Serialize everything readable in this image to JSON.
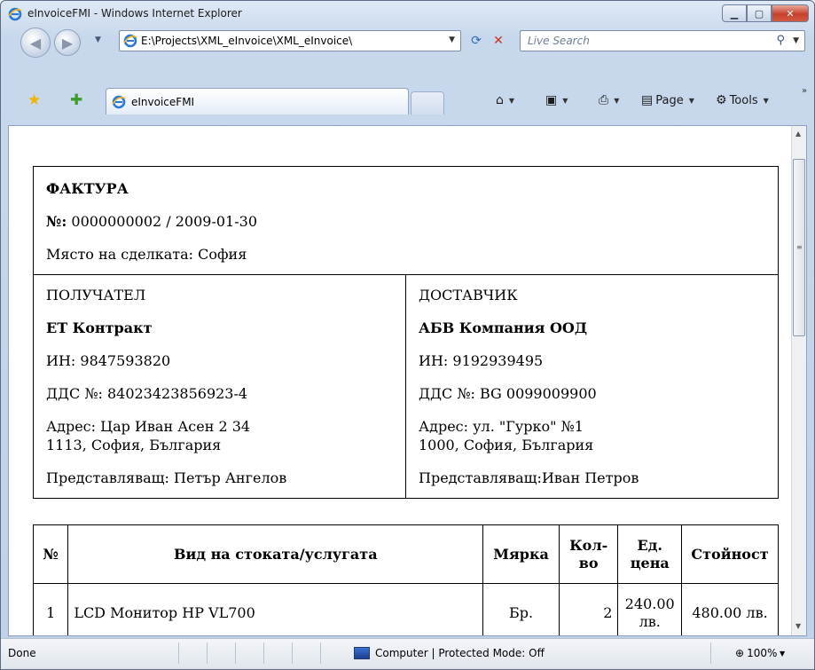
{
  "window": {
    "title": "eInvoiceFMI - Windows Internet Explorer",
    "address": "E:\\Projects\\XML_eInvoice\\XML_eInvoice\\",
    "search_placeholder": "Live Search",
    "tab_title": "eInvoiceFMI",
    "commands": {
      "page": "Page",
      "tools": "Tools"
    },
    "icons": [
      "ie-logo-icon",
      "back-arrow-icon",
      "forward-arrow-icon",
      "refresh-icon",
      "stop-icon",
      "search-icon",
      "favorites-star-icon",
      "add-favorite-icon",
      "home-icon",
      "feeds-icon",
      "print-icon",
      "page-icon",
      "tools-gear-icon",
      "computer-icon",
      "zoom-icon"
    ]
  },
  "invoice": {
    "title": "ФАКТУРА",
    "number_label": "№:",
    "number_value": "0000000002 / 2009-01-30",
    "place": "Място на сделката: София",
    "recipient": {
      "heading": "ПОЛУЧАТЕЛ",
      "name": "ЕТ Контракт",
      "id": "ИН: 9847593820",
      "vat": "ДДС №: 84023423856923-4",
      "address_line1": "Адрес: Цар Иван Асен 2 34",
      "address_line2": "1113, София, България",
      "representative": "Представляващ: Петър Ангелов"
    },
    "supplier": {
      "heading": "ДОСТАВЧИК",
      "name": "АБВ Компания ООД",
      "id": "ИН: 9192939495",
      "vat": "ДДС №: BG 0099009900",
      "address_line1": "Адрес: ул. \"Гурко\" №1",
      "address_line2": "1000, София, България",
      "representative": "Представляващ:Иван Петров"
    },
    "items_table": {
      "headers": {
        "num": "№",
        "name": "Вид на стоката/услугата",
        "unit": "Мярка",
        "qty": "Кол-во",
        "price": "Ед. цена",
        "total": "Стойност"
      },
      "rows": [
        {
          "num": "1",
          "name": "LCD Монитор HP VL700",
          "unit": "Бр.",
          "qty": "2",
          "price": "240.00 лв.",
          "total": "480.00 лв."
        }
      ]
    }
  },
  "status": {
    "text": "Done",
    "zone": "Computer | Protected Mode: Off",
    "zoom": "100%"
  }
}
